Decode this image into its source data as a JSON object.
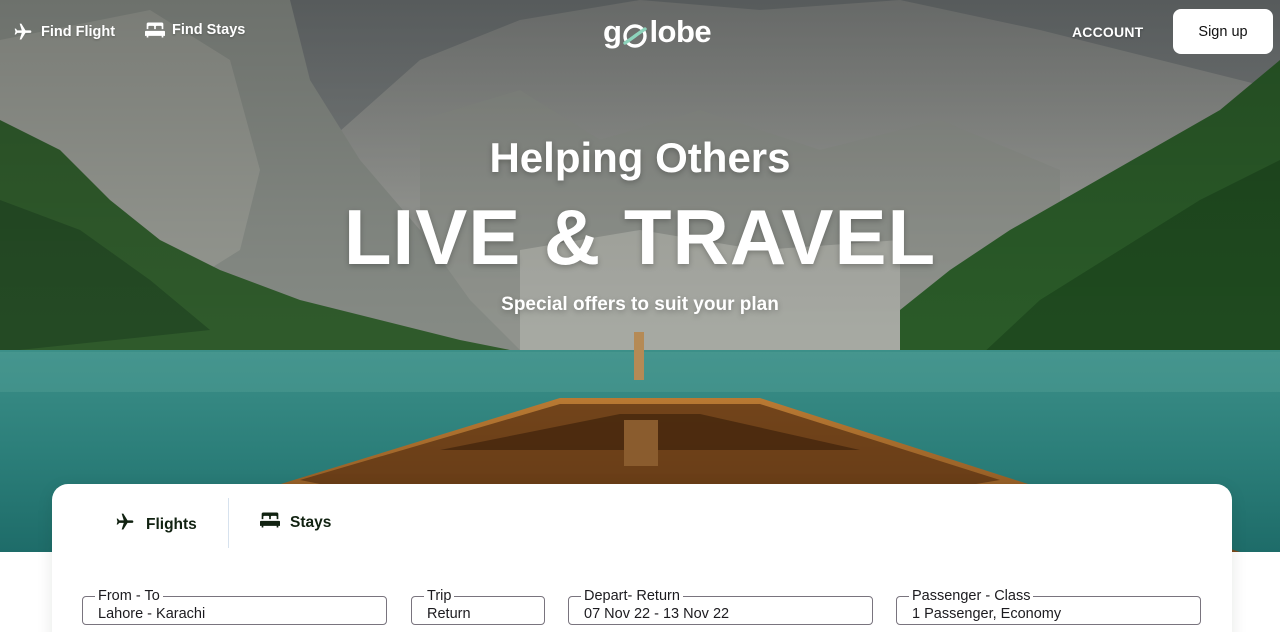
{
  "nav": {
    "find_flight": "Find Flight",
    "find_stays": "Find Stays",
    "logo": {
      "left": "g",
      "right": "lobe",
      "accent_color": "#8dd3bb"
    },
    "account": "ACCOUNT",
    "signup": "Sign up"
  },
  "hero": {
    "subtitle": "Helping Others",
    "title": "LIVE & TRAVEL",
    "tagline": "Special offers to suit your plan"
  },
  "search": {
    "tabs": [
      {
        "label": "Flights",
        "icon": "airplane-icon"
      },
      {
        "label": "Stays",
        "icon": "bed-icon"
      }
    ],
    "fields": {
      "from_to": {
        "label": "From - To",
        "value": "Lahore - Karachi"
      },
      "trip": {
        "label": "Trip",
        "value": "Return"
      },
      "depart_return": {
        "label": "Depart- Return",
        "value": "07 Nov 22 - 13 Nov 22"
      },
      "passenger_class": {
        "label": "Passenger - Class",
        "value": "1 Passenger, Economy"
      }
    }
  },
  "colors": {
    "ink": "#112211",
    "white": "#ffffff",
    "mint": "#8dd3bb",
    "border": "#79747e"
  }
}
